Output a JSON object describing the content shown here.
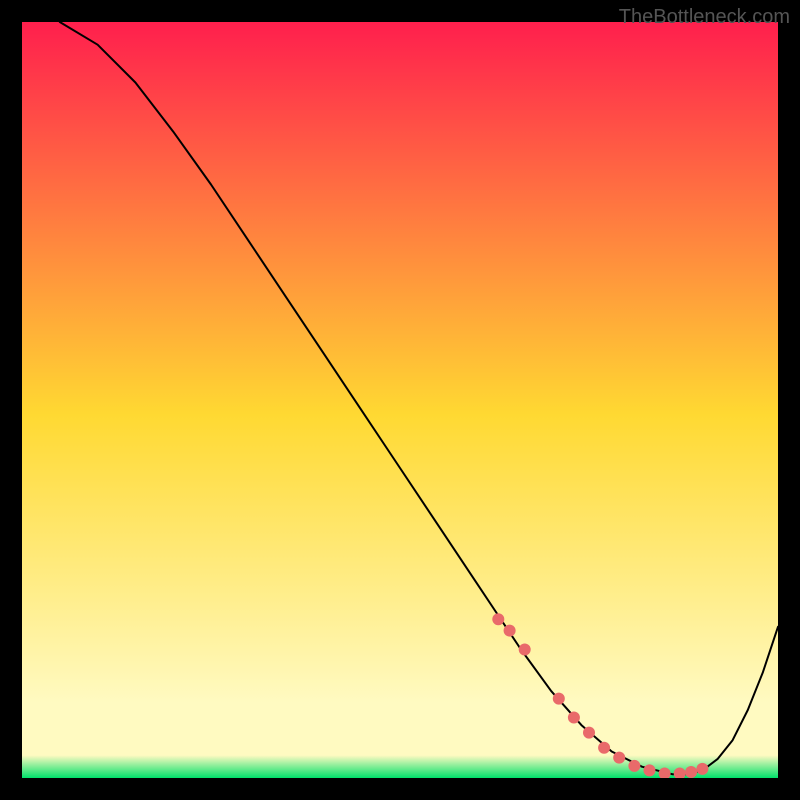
{
  "watermark": "TheBottleneck.com",
  "chart_data": {
    "type": "line",
    "title": "",
    "xlabel": "",
    "ylabel": "",
    "xlim": [
      0,
      100
    ],
    "ylim": [
      0,
      100
    ],
    "background_gradient": {
      "top_color": "#ff1f4d",
      "mid_color": "#ffd932",
      "low_band_color": "#fffac1",
      "bottom_color": "#00e06a"
    },
    "series": [
      {
        "name": "curve",
        "color": "#000000",
        "stroke_width": 2,
        "x": [
          5,
          10,
          15,
          20,
          25,
          30,
          35,
          40,
          45,
          50,
          55,
          60,
          63,
          66,
          70,
          74,
          78,
          82,
          86,
          88,
          90,
          92,
          94,
          96,
          98,
          100
        ],
        "y": [
          100,
          97,
          92,
          85.5,
          78.5,
          71,
          63.5,
          56,
          48.5,
          41,
          33.5,
          26,
          21.5,
          17,
          11.5,
          7,
          3.5,
          1.5,
          0.5,
          0.5,
          1,
          2.5,
          5,
          9,
          14,
          20
        ]
      }
    ],
    "markers": {
      "name": "highlight-dots",
      "color": "#e96a6a",
      "radius": 6,
      "x": [
        63,
        64.5,
        66.5,
        71,
        73,
        75,
        77,
        79,
        81,
        83,
        85,
        87,
        88.5,
        90
      ],
      "y": [
        21,
        19.5,
        17,
        10.5,
        8,
        6,
        4,
        2.7,
        1.6,
        1,
        0.6,
        0.6,
        0.8,
        1.2
      ]
    }
  }
}
